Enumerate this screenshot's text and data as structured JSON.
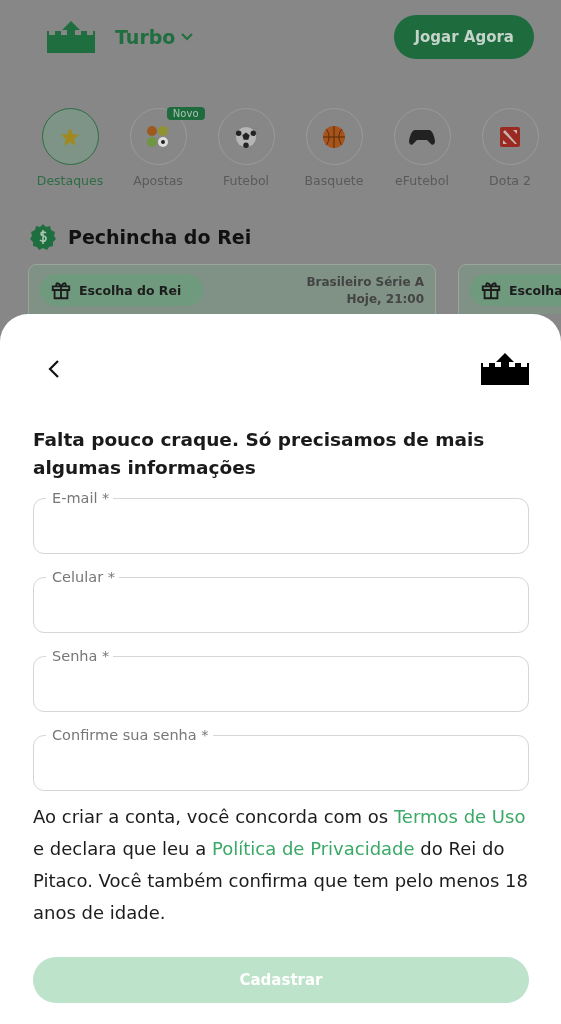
{
  "header": {
    "brand": "Turbo",
    "play_button": "Jogar Agora"
  },
  "categories": [
    {
      "label": "Destaques",
      "kind": "star",
      "selected": true
    },
    {
      "label": "Apostas",
      "kind": "balls",
      "selected": false,
      "badge": "Novo"
    },
    {
      "label": "Futebol",
      "kind": "soccer",
      "selected": false
    },
    {
      "label": "Basquete",
      "kind": "basketball",
      "selected": false
    },
    {
      "label": "eFutebol",
      "kind": "gamepad",
      "selected": false
    },
    {
      "label": "Dota 2",
      "kind": "dota",
      "selected": false
    }
  ],
  "section": {
    "title": "Pechincha do Rei",
    "cards": [
      {
        "chip": "Escolha do Rei",
        "league": "Brasileiro Série A",
        "time": "Hoje, 21:00"
      },
      {
        "chip": "Escolha"
      }
    ]
  },
  "sheet": {
    "heading": "Falta pouco craque. Só precisamos de mais algumas informações",
    "fields": [
      {
        "label": "E-mail *"
      },
      {
        "label": "Celular *"
      },
      {
        "label": "Senha *"
      },
      {
        "label": "Confirme sua senha *"
      }
    ],
    "terms": [
      {
        "kind": "text",
        "text": "Ao criar a conta, você concorda com os "
      },
      {
        "kind": "link",
        "text": "Termos de Uso"
      },
      {
        "kind": "text",
        "text": " e declara que leu a "
      },
      {
        "kind": "link",
        "text": "Política de Privacidade"
      },
      {
        "kind": "text",
        "text": " do Rei do Pitaco. Você também confirma que tem pelo menos 18 anos de idade."
      }
    ],
    "submit": {
      "label": "Cadastrar",
      "disabled": true
    }
  }
}
